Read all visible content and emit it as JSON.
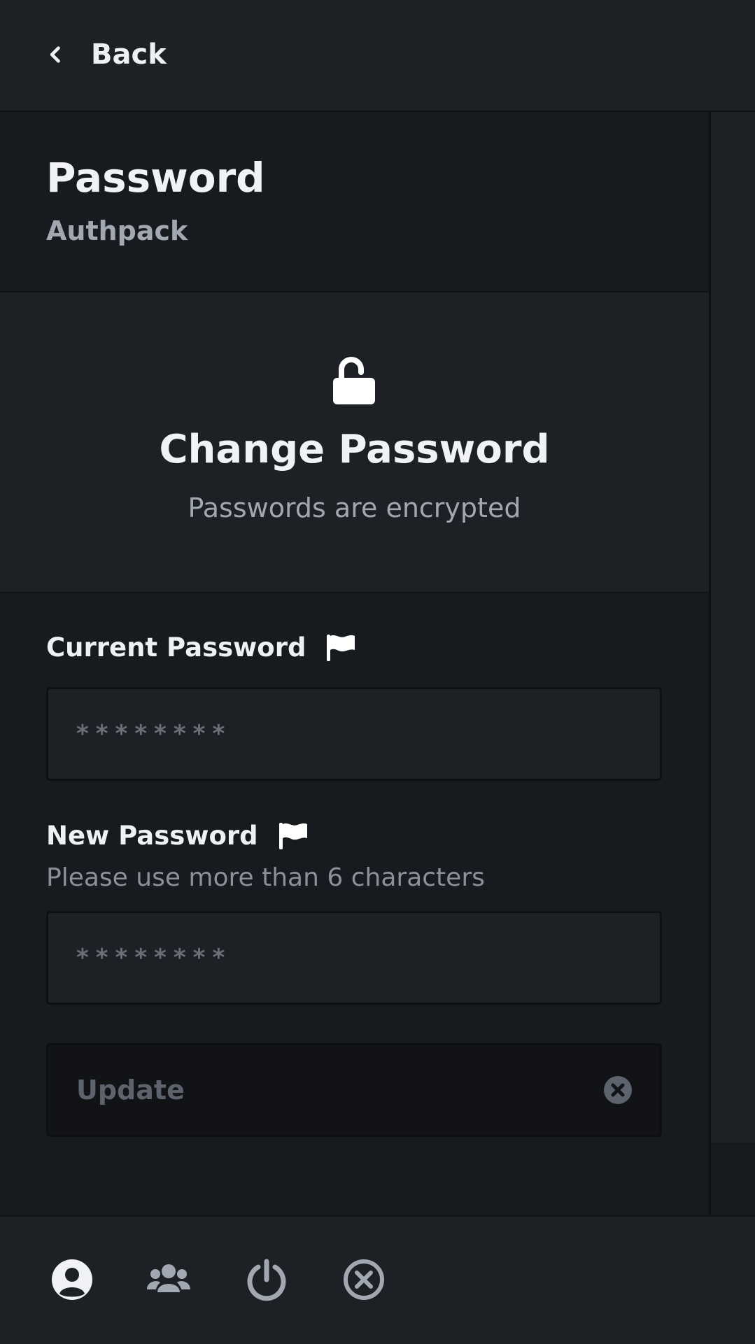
{
  "topbar": {
    "back_label": "Back",
    "back_icon": "chevron-left-icon"
  },
  "header": {
    "title": "Password",
    "subtitle": "Authpack"
  },
  "hero": {
    "icon": "lock-open-icon",
    "title": "Change Password",
    "subtitle": "Passwords are encrypted"
  },
  "form": {
    "current_password": {
      "label": "Current Password",
      "flag_icon": "flag-icon",
      "placeholder": "********",
      "value": ""
    },
    "new_password": {
      "label": "New Password",
      "flag_icon": "flag-icon",
      "hint": "Please use more than 6 characters",
      "placeholder": "********",
      "value": ""
    },
    "update_button": {
      "label": "Update",
      "icon": "close-circle-icon",
      "disabled": true
    }
  },
  "bottom_nav": {
    "items": [
      {
        "name": "account",
        "icon": "user-circle-icon",
        "active": true
      },
      {
        "name": "teams",
        "icon": "users-icon",
        "active": false
      },
      {
        "name": "logout",
        "icon": "power-icon",
        "active": false
      },
      {
        "name": "close",
        "icon": "close-circle-outline-icon",
        "active": false
      }
    ]
  },
  "colors": {
    "background": "#171a1e",
    "panel": "#1d2025",
    "text_primary": "#f1f2f5",
    "text_secondary": "#a2a8b2",
    "nav_icon_inactive": "#a2a8b2",
    "nav_icon_active": "#f1f2f5"
  }
}
